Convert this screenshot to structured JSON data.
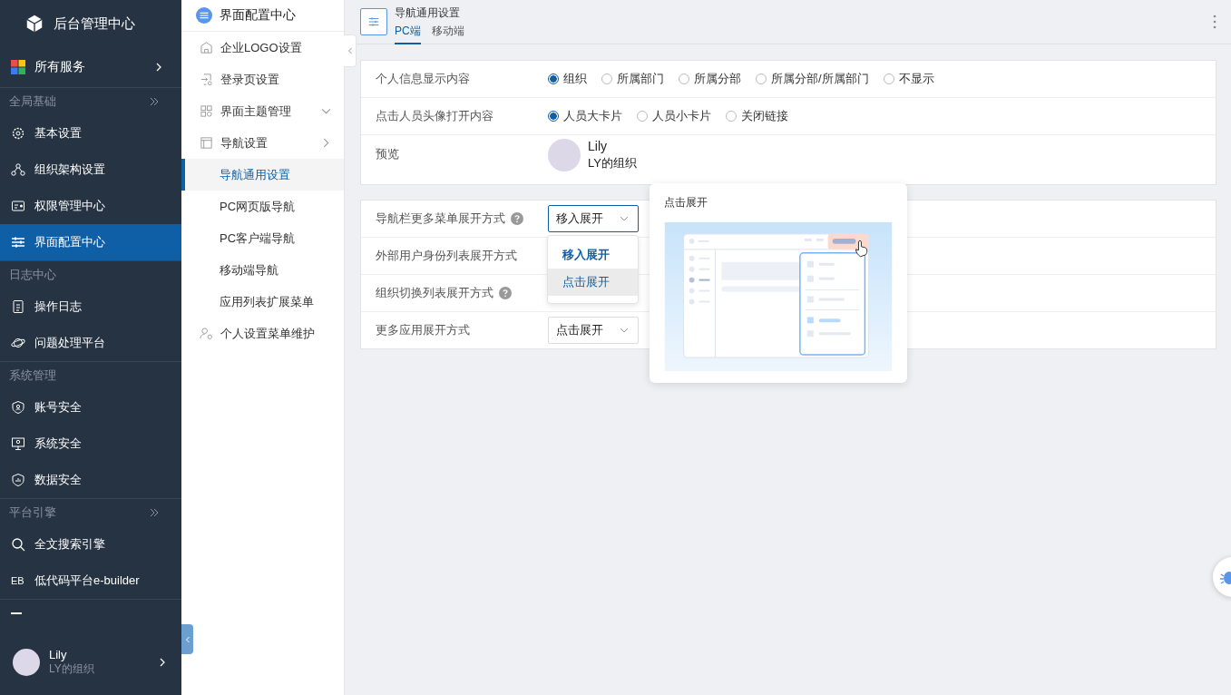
{
  "sidebar": {
    "brand": "后台管理中心",
    "all_services": "所有服务",
    "groups": [
      {
        "title": "全局基础",
        "collapsible": true,
        "items": [
          {
            "label": "基本设置",
            "selected": false
          },
          {
            "label": "组织架构设置",
            "selected": false
          },
          {
            "label": "权限管理中心",
            "selected": false
          },
          {
            "label": "界面配置中心",
            "selected": true
          }
        ]
      },
      {
        "title": "日志中心",
        "collapsible": false,
        "items": [
          {
            "label": "操作日志",
            "selected": false
          },
          {
            "label": "问题处理平台",
            "selected": false
          }
        ]
      },
      {
        "title": "系统管理",
        "collapsible": false,
        "items": [
          {
            "label": "账号安全",
            "selected": false
          },
          {
            "label": "系统安全",
            "selected": false
          },
          {
            "label": "数据安全",
            "selected": false
          }
        ]
      },
      {
        "title": "平台引擎",
        "collapsible": true,
        "items": [
          {
            "label": "全文搜索引擎",
            "selected": false
          },
          {
            "label": "低代码平台e-builder",
            "selected": false,
            "glyph": "EB"
          }
        ]
      }
    ],
    "user": {
      "name": "Lily",
      "org": "LY的组织"
    }
  },
  "subnav": {
    "title": "界面配置中心",
    "items": [
      {
        "label": "企业LOGO设置"
      },
      {
        "label": "登录页设置"
      },
      {
        "label": "界面主题管理",
        "expanded": false
      },
      {
        "label": "导航设置",
        "expanded": true,
        "children": [
          {
            "label": "导航通用设置",
            "selected": true
          },
          {
            "label": "PC网页版导航",
            "selected": false
          },
          {
            "label": "PC客户端导航",
            "selected": false
          },
          {
            "label": "移动端导航",
            "selected": false
          },
          {
            "label": "应用列表扩展菜单",
            "selected": false
          }
        ]
      },
      {
        "label": "个人设置菜单维护"
      }
    ]
  },
  "page": {
    "title": "导航通用设置",
    "tabs": [
      {
        "label": "PC端",
        "selected": true
      },
      {
        "label": "移动端",
        "selected": false
      }
    ]
  },
  "profile_card": {
    "rows": [
      {
        "kind": "radio",
        "label": "个人信息显示内容",
        "options": [
          {
            "label": "组织",
            "selected": true
          },
          {
            "label": "所属部门",
            "selected": false
          },
          {
            "label": "所属分部",
            "selected": false
          },
          {
            "label": "所属分部/所属部门",
            "selected": false
          },
          {
            "label": "不显示",
            "selected": false
          }
        ]
      },
      {
        "kind": "radio",
        "label": "点击人员头像打开内容",
        "options": [
          {
            "label": "人员大卡片",
            "selected": true
          },
          {
            "label": "人员小卡片",
            "selected": false
          },
          {
            "label": "关闭链接",
            "selected": false
          }
        ]
      },
      {
        "kind": "preview",
        "label": "预览",
        "name": "Lily",
        "org": "LY的组织"
      }
    ]
  },
  "expand_card": {
    "rows": [
      {
        "label": "导航栏更多菜单展开方式",
        "help": true,
        "value": "移入展开",
        "focused": true
      },
      {
        "label": "外部用户身份列表展开方式",
        "help": false
      },
      {
        "label": "组织切换列表展开方式",
        "help": true
      },
      {
        "label": "更多应用展开方式",
        "help": false,
        "value": "点击展开",
        "focused": false
      }
    ]
  },
  "dropdown": {
    "options": [
      {
        "label": "移入展开",
        "selected": true,
        "hovered": false
      },
      {
        "label": "点击展开",
        "selected": false,
        "hovered": true
      }
    ]
  },
  "preview_popover": {
    "title": "点击展开"
  }
}
